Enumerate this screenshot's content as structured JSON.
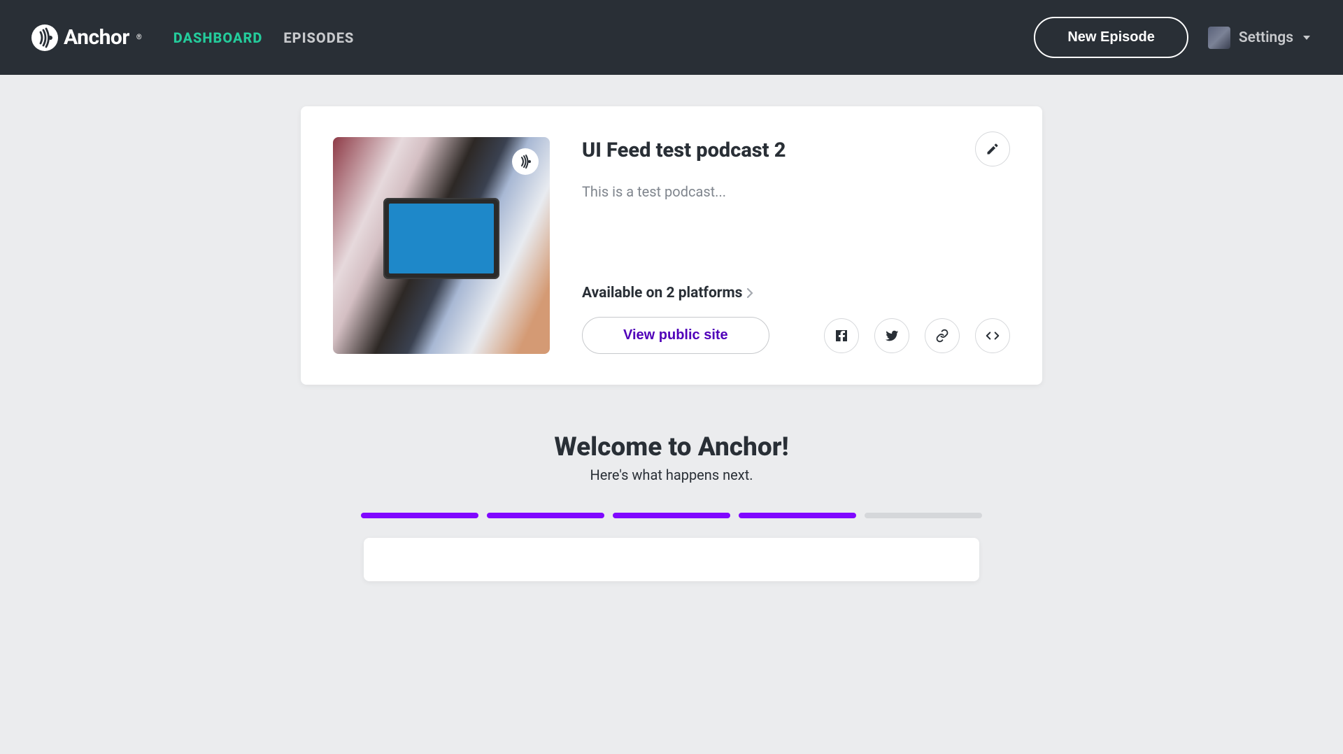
{
  "header": {
    "brand": "Anchor",
    "nav": {
      "dashboard": "DASHBOARD",
      "episodes": "EPISODES"
    },
    "new_episode": "New Episode",
    "settings": "Settings"
  },
  "podcast": {
    "title": "UI Feed test podcast 2",
    "description": "This is a test podcast...",
    "platforms_label": "Available on 2 platforms",
    "platforms_count": 2,
    "view_public": "View public site"
  },
  "welcome": {
    "title": "Welcome to Anchor!",
    "subtitle": "Here's what happens next.",
    "progress": {
      "total": 5,
      "completed": 4
    }
  },
  "colors": {
    "accent_green": "#24cb9b",
    "accent_purple": "#8008ff",
    "text_purple": "#5000b9",
    "bg_dark": "#292f36"
  }
}
